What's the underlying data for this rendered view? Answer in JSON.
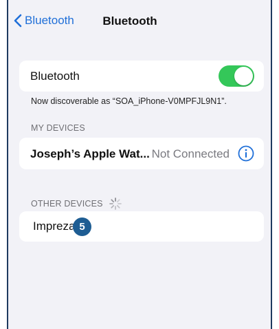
{
  "nav": {
    "back_label": "Bluetooth",
    "title": "Bluetooth"
  },
  "bluetooth": {
    "label": "Bluetooth",
    "enabled": true,
    "discoverable_text": "Now discoverable as “SOA_iPhone-V0MPFJL9N1”."
  },
  "my_devices": {
    "header": "MY DEVICES",
    "items": [
      {
        "name": "Joseph’s Apple Wat...",
        "status": "Not Connected"
      }
    ]
  },
  "other_devices": {
    "header": "OTHER DEVICES",
    "items": [
      {
        "name": "Impreza"
      }
    ]
  },
  "badge": {
    "value": "5",
    "color": "#1e5d93"
  },
  "colors": {
    "accent": "#1f6fd8",
    "toggle_on": "#34c759",
    "background": "#f2f2f7"
  }
}
